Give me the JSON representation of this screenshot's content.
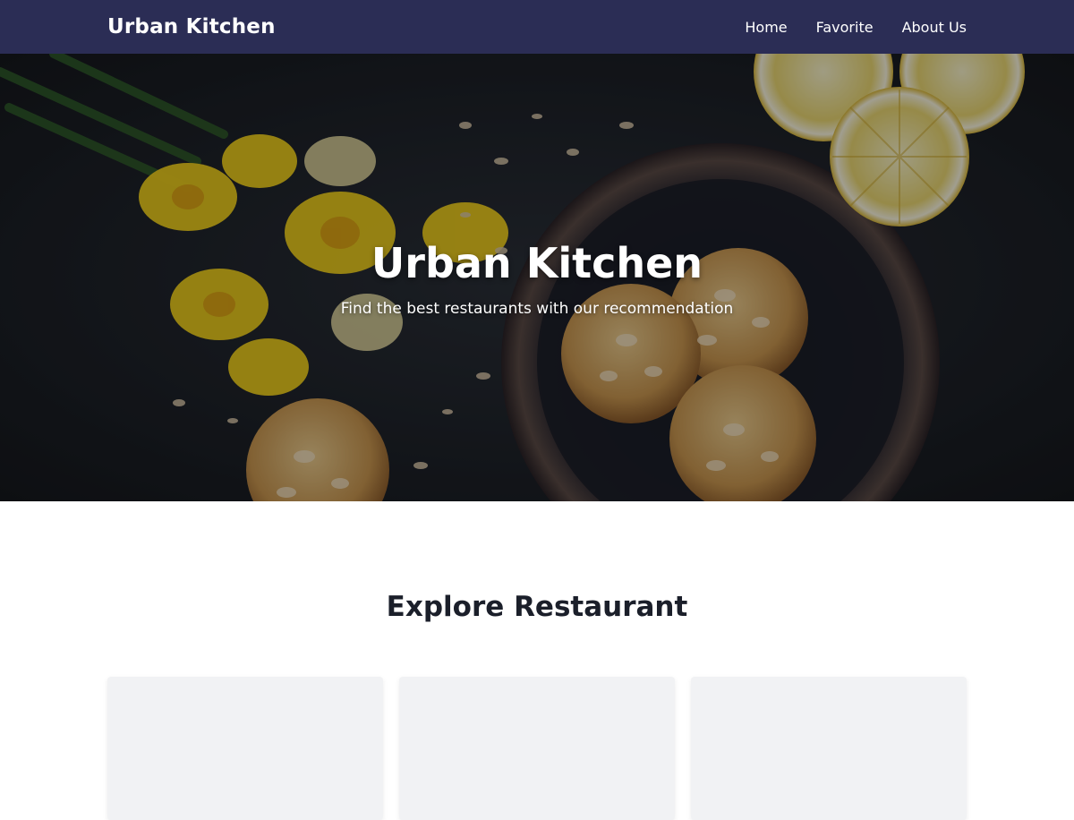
{
  "navbar": {
    "brand": "Urban Kitchen",
    "links": [
      {
        "label": "Home"
      },
      {
        "label": "Favorite"
      },
      {
        "label": "About Us"
      }
    ]
  },
  "hero": {
    "title": "Urban Kitchen",
    "subtitle": "Find the best restaurants with our recommendation"
  },
  "explore": {
    "title": "Explore Restaurant",
    "cards_count": 3
  },
  "colors": {
    "navbar_bg": "#2b2d55",
    "card_bg": "#f1f2f4",
    "title_text": "#1b1f2a"
  }
}
